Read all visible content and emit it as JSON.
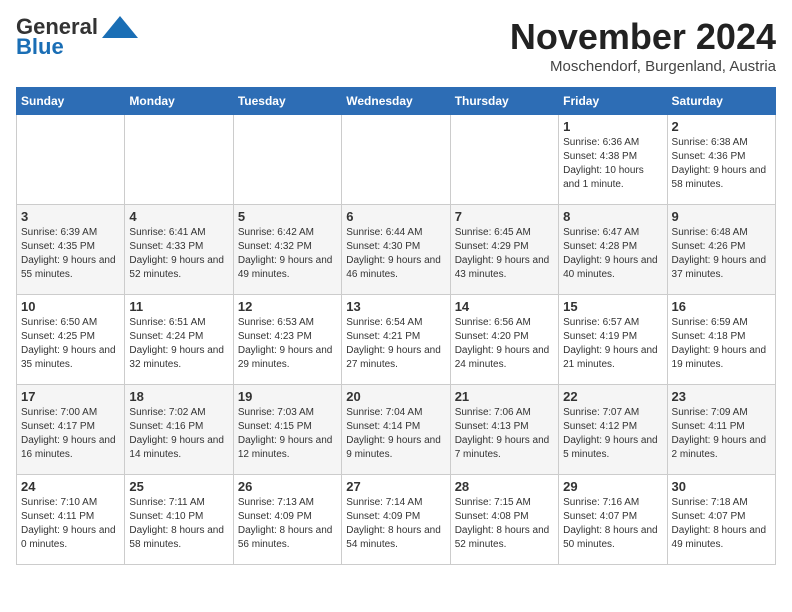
{
  "header": {
    "logo_line1": "General",
    "logo_line2": "Blue",
    "month_title": "November 2024",
    "location": "Moschendorf, Burgenland, Austria"
  },
  "weekdays": [
    "Sunday",
    "Monday",
    "Tuesday",
    "Wednesday",
    "Thursday",
    "Friday",
    "Saturday"
  ],
  "weeks": [
    [
      {
        "day": "",
        "info": ""
      },
      {
        "day": "",
        "info": ""
      },
      {
        "day": "",
        "info": ""
      },
      {
        "day": "",
        "info": ""
      },
      {
        "day": "",
        "info": ""
      },
      {
        "day": "1",
        "info": "Sunrise: 6:36 AM\nSunset: 4:38 PM\nDaylight: 10 hours and 1 minute."
      },
      {
        "day": "2",
        "info": "Sunrise: 6:38 AM\nSunset: 4:36 PM\nDaylight: 9 hours and 58 minutes."
      }
    ],
    [
      {
        "day": "3",
        "info": "Sunrise: 6:39 AM\nSunset: 4:35 PM\nDaylight: 9 hours and 55 minutes."
      },
      {
        "day": "4",
        "info": "Sunrise: 6:41 AM\nSunset: 4:33 PM\nDaylight: 9 hours and 52 minutes."
      },
      {
        "day": "5",
        "info": "Sunrise: 6:42 AM\nSunset: 4:32 PM\nDaylight: 9 hours and 49 minutes."
      },
      {
        "day": "6",
        "info": "Sunrise: 6:44 AM\nSunset: 4:30 PM\nDaylight: 9 hours and 46 minutes."
      },
      {
        "day": "7",
        "info": "Sunrise: 6:45 AM\nSunset: 4:29 PM\nDaylight: 9 hours and 43 minutes."
      },
      {
        "day": "8",
        "info": "Sunrise: 6:47 AM\nSunset: 4:28 PM\nDaylight: 9 hours and 40 minutes."
      },
      {
        "day": "9",
        "info": "Sunrise: 6:48 AM\nSunset: 4:26 PM\nDaylight: 9 hours and 37 minutes."
      }
    ],
    [
      {
        "day": "10",
        "info": "Sunrise: 6:50 AM\nSunset: 4:25 PM\nDaylight: 9 hours and 35 minutes."
      },
      {
        "day": "11",
        "info": "Sunrise: 6:51 AM\nSunset: 4:24 PM\nDaylight: 9 hours and 32 minutes."
      },
      {
        "day": "12",
        "info": "Sunrise: 6:53 AM\nSunset: 4:23 PM\nDaylight: 9 hours and 29 minutes."
      },
      {
        "day": "13",
        "info": "Sunrise: 6:54 AM\nSunset: 4:21 PM\nDaylight: 9 hours and 27 minutes."
      },
      {
        "day": "14",
        "info": "Sunrise: 6:56 AM\nSunset: 4:20 PM\nDaylight: 9 hours and 24 minutes."
      },
      {
        "day": "15",
        "info": "Sunrise: 6:57 AM\nSunset: 4:19 PM\nDaylight: 9 hours and 21 minutes."
      },
      {
        "day": "16",
        "info": "Sunrise: 6:59 AM\nSunset: 4:18 PM\nDaylight: 9 hours and 19 minutes."
      }
    ],
    [
      {
        "day": "17",
        "info": "Sunrise: 7:00 AM\nSunset: 4:17 PM\nDaylight: 9 hours and 16 minutes."
      },
      {
        "day": "18",
        "info": "Sunrise: 7:02 AM\nSunset: 4:16 PM\nDaylight: 9 hours and 14 minutes."
      },
      {
        "day": "19",
        "info": "Sunrise: 7:03 AM\nSunset: 4:15 PM\nDaylight: 9 hours and 12 minutes."
      },
      {
        "day": "20",
        "info": "Sunrise: 7:04 AM\nSunset: 4:14 PM\nDaylight: 9 hours and 9 minutes."
      },
      {
        "day": "21",
        "info": "Sunrise: 7:06 AM\nSunset: 4:13 PM\nDaylight: 9 hours and 7 minutes."
      },
      {
        "day": "22",
        "info": "Sunrise: 7:07 AM\nSunset: 4:12 PM\nDaylight: 9 hours and 5 minutes."
      },
      {
        "day": "23",
        "info": "Sunrise: 7:09 AM\nSunset: 4:11 PM\nDaylight: 9 hours and 2 minutes."
      }
    ],
    [
      {
        "day": "24",
        "info": "Sunrise: 7:10 AM\nSunset: 4:11 PM\nDaylight: 9 hours and 0 minutes."
      },
      {
        "day": "25",
        "info": "Sunrise: 7:11 AM\nSunset: 4:10 PM\nDaylight: 8 hours and 58 minutes."
      },
      {
        "day": "26",
        "info": "Sunrise: 7:13 AM\nSunset: 4:09 PM\nDaylight: 8 hours and 56 minutes."
      },
      {
        "day": "27",
        "info": "Sunrise: 7:14 AM\nSunset: 4:09 PM\nDaylight: 8 hours and 54 minutes."
      },
      {
        "day": "28",
        "info": "Sunrise: 7:15 AM\nSunset: 4:08 PM\nDaylight: 8 hours and 52 minutes."
      },
      {
        "day": "29",
        "info": "Sunrise: 7:16 AM\nSunset: 4:07 PM\nDaylight: 8 hours and 50 minutes."
      },
      {
        "day": "30",
        "info": "Sunrise: 7:18 AM\nSunset: 4:07 PM\nDaylight: 8 hours and 49 minutes."
      }
    ]
  ]
}
